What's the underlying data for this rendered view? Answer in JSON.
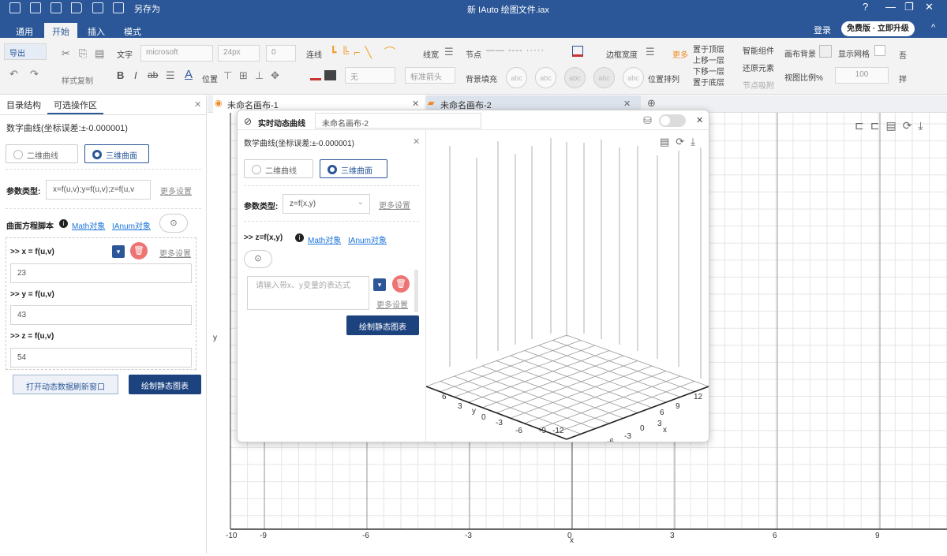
{
  "titlebar": {
    "save_as": "另存为",
    "document_title": "新 IAuto 绘图文件.iax"
  },
  "menu": {
    "tabs": [
      "通用",
      "开始",
      "插入",
      "模式"
    ],
    "login": "登录",
    "upgrade": "免费版 · 立即升级"
  },
  "ribbon": {
    "export": "导出",
    "text": "文字",
    "font": "microsoft",
    "size": "24px",
    "spacing": "0",
    "connect": "连线",
    "line_width": "线宽",
    "format_copy": "样式复制",
    "position": "位置",
    "none": "无",
    "arrow": "标准箭头",
    "node": "节点",
    "bg_fill": "背景填充",
    "style_abc": "abc",
    "border_width": "边框宽度",
    "more": "更多",
    "to_top": "置于顶层",
    "move_up": "上移一层",
    "move_down": "下移一层",
    "to_bottom": "置于底层",
    "align": "位置排列",
    "smart": "智能组件",
    "restore": "还原元素",
    "node_snap": "节点吸附",
    "canvas_bg": "画布背景",
    "show_grid": "显示网格",
    "view_scale": "视图比例%",
    "scale_val": "100",
    "side1": "吾",
    "side2": "拌"
  },
  "left": {
    "tab1": "目录结构",
    "tab2": "可选操作区",
    "heading": "数字曲线(坐标误差:±-0.000001)",
    "radio_2d": "二维曲线",
    "radio_3d": "三维曲面",
    "param_label": "参数类型:",
    "param_value": "x=f(u,v);y=f(u,v);z=f(u,v",
    "more": "更多设置",
    "script_label": "曲面方程脚本",
    "math": "Math对象",
    "ianum": "IAnum对象",
    "x_label": ">> x = f(u,v)",
    "x_val": "23",
    "y_label": ">> y = f(u,v)",
    "y_val": "43",
    "z_label": ">> z = f(u,v)",
    "z_val": "54",
    "open_btn": "打开动态数据刷新窗口",
    "draw_btn": "绘制静态图表"
  },
  "doctabs": {
    "tab1": "未命名画布-1",
    "tab2": "未命名画布-2"
  },
  "canvas": {
    "y_axis": "y",
    "x_axis": "x",
    "xticks": [
      "-10",
      "-9",
      "-6",
      "-3",
      "0",
      "3",
      "6",
      "9"
    ]
  },
  "popup": {
    "title": "实时动态曲线",
    "tab": "未命名画布-2",
    "heading": "数学曲线(坐标误差:±-0.000001)",
    "radio_2d": "二维曲线",
    "radio_3d": "三维曲面",
    "param_label": "参数类型:",
    "param_value": "z=f(x,y)",
    "more": "更多设置",
    "script_label": ">> z=f(x,y)",
    "math": "Math对象",
    "ianum": "IAnum对象",
    "placeholder": "请输入带x、y变量的表达式",
    "draw_btn": "绘制静态图表",
    "plot_labels": [
      "6",
      "3",
      "y",
      "0",
      "-3",
      "-6",
      "-9",
      "-12",
      "12",
      "9",
      "6",
      "3",
      "0",
      "x",
      "-3",
      "-6",
      "-9"
    ]
  }
}
